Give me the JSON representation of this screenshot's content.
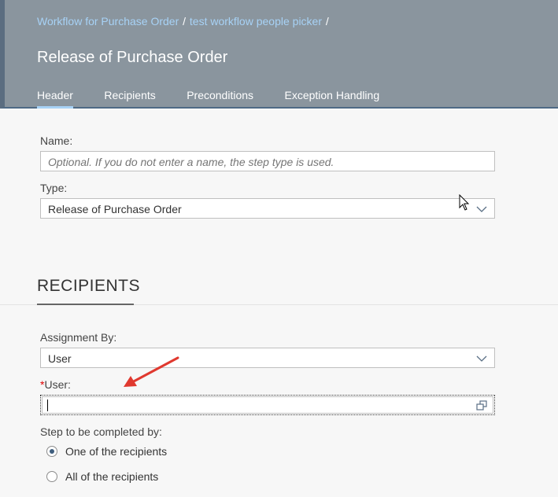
{
  "breadcrumb": {
    "items": [
      "Workflow for Purchase Order",
      "test workflow people picker"
    ],
    "separator": "/"
  },
  "page_title": "Release of Purchase Order",
  "tabs": [
    {
      "label": "Header",
      "active": true
    },
    {
      "label": "Recipients",
      "active": false
    },
    {
      "label": "Preconditions",
      "active": false
    },
    {
      "label": "Exception Handling",
      "active": false
    }
  ],
  "form": {
    "name": {
      "label": "Name:",
      "placeholder": "Optional. If you do not enter a name, the step type is used.",
      "value": ""
    },
    "type": {
      "label": "Type:",
      "value": "Release of Purchase Order"
    }
  },
  "recipients": {
    "title": "RECIPIENTS",
    "assignment_by": {
      "label": "Assignment By:",
      "value": "User"
    },
    "user": {
      "required_mark": "*",
      "label": "User:",
      "value": ""
    },
    "completed_by": {
      "label": "Step to be completed by:",
      "options": [
        {
          "label": "One of the recipients",
          "selected": true
        },
        {
          "label": "All of the recipients",
          "selected": false
        }
      ]
    }
  },
  "colors": {
    "header_bg": "#8a959e",
    "link": "#a7d2f6",
    "required": "#e00000",
    "annotation_arrow": "#e0392f"
  },
  "icons": {
    "dropdown": "chevron-down-icon",
    "value_help": "value-help-icon",
    "annotation": "red-arrow-icon"
  }
}
